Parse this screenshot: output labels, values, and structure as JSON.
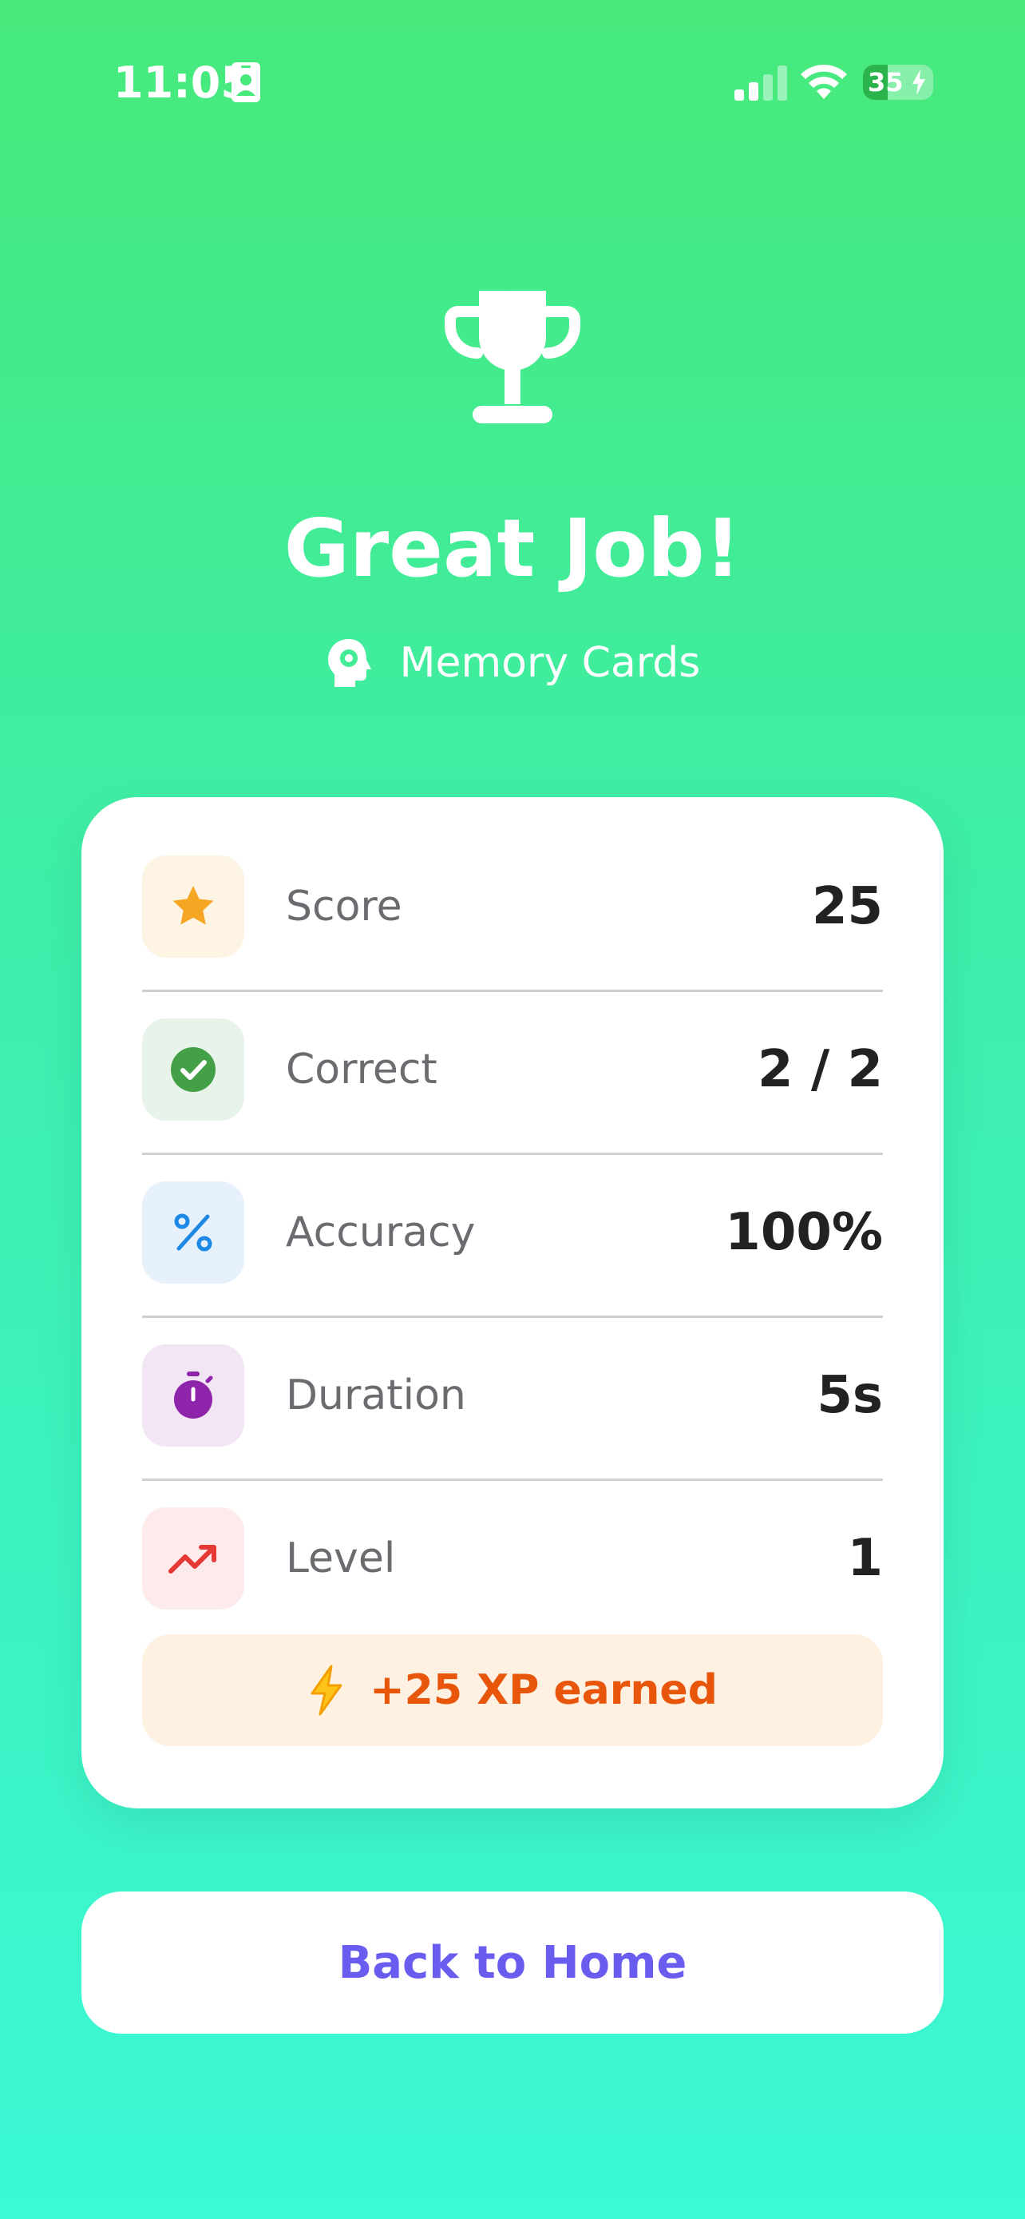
{
  "status_bar": {
    "time": "11:05",
    "battery_level": "35",
    "icons": [
      "id-card-icon",
      "signal-icon",
      "wifi-icon",
      "battery-icon"
    ]
  },
  "hero": {
    "icon": "trophy-icon",
    "title": "Great Job!",
    "game_icon": "brain-gear-icon",
    "game_name": "Memory Cards"
  },
  "stats": {
    "rows": [
      {
        "icon": "star-icon",
        "label": "Score",
        "value": "25",
        "color": "#F5A623",
        "bg": "#FEF4E4"
      },
      {
        "icon": "check-circle-icon",
        "label": "Correct",
        "value": "2 / 2",
        "color": "#43A047",
        "bg": "#E8F3E9"
      },
      {
        "icon": "percent-icon",
        "label": "Accuracy",
        "value": "100%",
        "color": "#1E88E5",
        "bg": "#E6F1FC"
      },
      {
        "icon": "stopwatch-icon",
        "label": "Duration",
        "value": "5s",
        "color": "#8E24AA",
        "bg": "#F2E6F4"
      },
      {
        "icon": "trending-up-icon",
        "label": "Level",
        "value": "1",
        "color": "#E53935",
        "bg": "#FDEAEA"
      }
    ],
    "xp": {
      "icon": "lightning-icon",
      "text": "+25 XP earned",
      "color": "#E8560C",
      "bg": "#FEF1E2"
    }
  },
  "actions": {
    "home_label": "Back to Home",
    "accent": "#6B5CF0"
  }
}
